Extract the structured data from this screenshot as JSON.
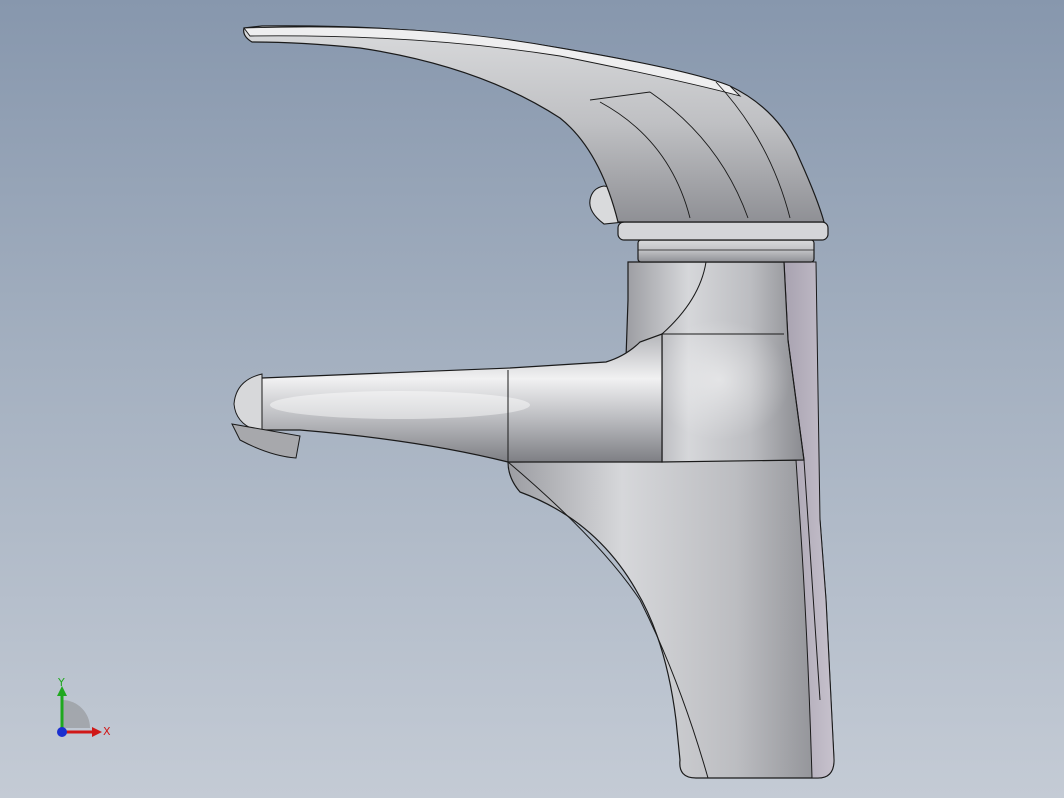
{
  "viewport": {
    "background_top": "#8797ad",
    "background_bottom": "#c4cbd5"
  },
  "model": {
    "name": "faucet-model",
    "surface_color": "#c9cacd",
    "edge_color": "#1a1a1a"
  },
  "triad": {
    "y_label": "Y",
    "x_label": "X",
    "y_color": "#1fa81f",
    "x_color": "#d01818",
    "z_color": "#1a2fd0"
  }
}
